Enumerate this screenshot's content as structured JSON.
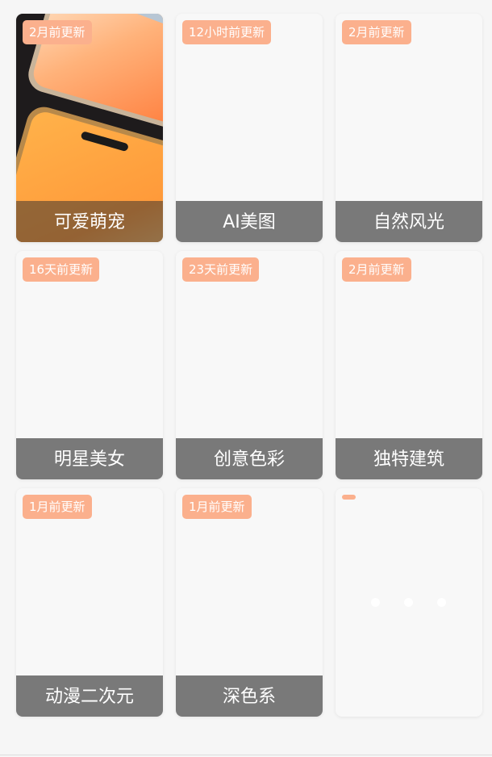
{
  "categories": [
    {
      "badge": "2月前更新",
      "title": "可爱萌宠"
    },
    {
      "badge": "12小时前更新",
      "title": "AI美图"
    },
    {
      "badge": "2月前更新",
      "title": "自然风光"
    },
    {
      "badge": "16天前更新",
      "title": "明星美女"
    },
    {
      "badge": "23天前更新",
      "title": "创意色彩"
    },
    {
      "badge": "2月前更新",
      "title": "独特建筑"
    },
    {
      "badge": "1月前更新",
      "title": "动漫二次元"
    },
    {
      "badge": "1月前更新",
      "title": "深色系"
    }
  ],
  "colors": {
    "badge": "#fbb08d",
    "label_bar": "#6e6e6e",
    "card": "#f8f8f8",
    "background": "#f6f6f6"
  },
  "loading_card": {
    "state": "loading"
  }
}
